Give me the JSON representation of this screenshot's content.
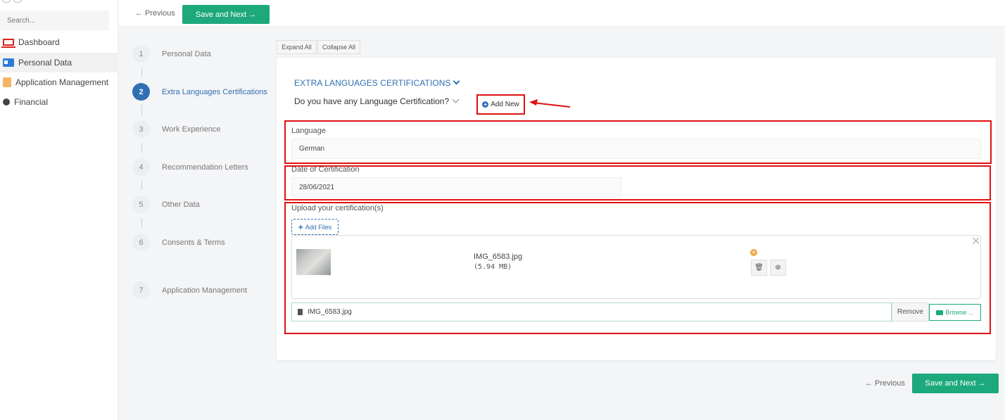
{
  "sidebar": {
    "search_placeholder": "Search...",
    "items": [
      {
        "label": "Dashboard",
        "icon": "laptop-icon"
      },
      {
        "label": "Personal Data",
        "icon": "id-card-icon"
      },
      {
        "label": "Application Management",
        "icon": "document-icon"
      },
      {
        "label": "Financial",
        "icon": "coins-icon"
      }
    ]
  },
  "topbar": {
    "previous_label": "← Previous",
    "save_next_label": "Save and Next →"
  },
  "steps": [
    {
      "num": "1",
      "label": "Personal Data"
    },
    {
      "num": "2",
      "label": "Extra Languages Certifications"
    },
    {
      "num": "3",
      "label": "Work Experience"
    },
    {
      "num": "4",
      "label": "Recommendation Letters"
    },
    {
      "num": "5",
      "label": "Other Data"
    },
    {
      "num": "6",
      "label": "Consents & Terms"
    },
    {
      "num": "7",
      "label": "Application Management"
    }
  ],
  "toolbar": {
    "expand_all": "Expand All",
    "collapse_all": "Collapse All"
  },
  "form": {
    "section_title": "EXTRA LANGUAGES CERTIFICATIONS",
    "question": "Do you have any Language Certification?",
    "add_new_label": "Add New",
    "language_label": "Language",
    "language_value": "German",
    "date_label": "Date of Certification",
    "date_value": "28/06/2021",
    "upload_label": "Upload your certification(s)",
    "add_files_label": "Add Files",
    "file": {
      "name": "IMG_6583.jpg",
      "size": "(5.94 MB)"
    },
    "caption_value": "IMG_6583.jpg",
    "remove_label": "Remove",
    "browse_label": "Browse ..."
  },
  "footer": {
    "previous_label": "← Previous",
    "save_next_label": "Save and Next →"
  },
  "colors": {
    "accent_green": "#1ea97c",
    "accent_blue": "#2f6fb2",
    "highlight_red": "#e01010"
  }
}
